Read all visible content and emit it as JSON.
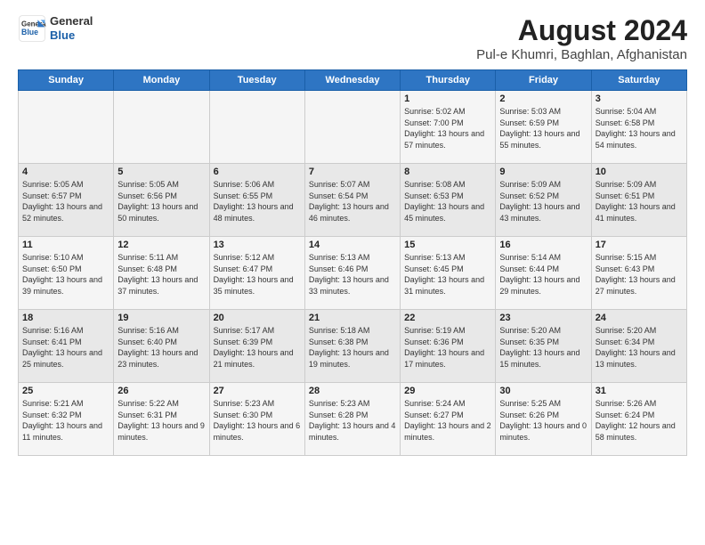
{
  "logo": {
    "line1": "General",
    "line2": "Blue"
  },
  "title": "August 2024",
  "subtitle": "Pul-e Khumri, Baghlan, Afghanistan",
  "days_of_week": [
    "Sunday",
    "Monday",
    "Tuesday",
    "Wednesday",
    "Thursday",
    "Friday",
    "Saturday"
  ],
  "weeks": [
    [
      {
        "day": "",
        "content": ""
      },
      {
        "day": "",
        "content": ""
      },
      {
        "day": "",
        "content": ""
      },
      {
        "day": "",
        "content": ""
      },
      {
        "day": "1",
        "content": "Sunrise: 5:02 AM\nSunset: 7:00 PM\nDaylight: 13 hours\nand 57 minutes."
      },
      {
        "day": "2",
        "content": "Sunrise: 5:03 AM\nSunset: 6:59 PM\nDaylight: 13 hours\nand 55 minutes."
      },
      {
        "day": "3",
        "content": "Sunrise: 5:04 AM\nSunset: 6:58 PM\nDaylight: 13 hours\nand 54 minutes."
      }
    ],
    [
      {
        "day": "4",
        "content": "Sunrise: 5:05 AM\nSunset: 6:57 PM\nDaylight: 13 hours\nand 52 minutes."
      },
      {
        "day": "5",
        "content": "Sunrise: 5:05 AM\nSunset: 6:56 PM\nDaylight: 13 hours\nand 50 minutes."
      },
      {
        "day": "6",
        "content": "Sunrise: 5:06 AM\nSunset: 6:55 PM\nDaylight: 13 hours\nand 48 minutes."
      },
      {
        "day": "7",
        "content": "Sunrise: 5:07 AM\nSunset: 6:54 PM\nDaylight: 13 hours\nand 46 minutes."
      },
      {
        "day": "8",
        "content": "Sunrise: 5:08 AM\nSunset: 6:53 PM\nDaylight: 13 hours\nand 45 minutes."
      },
      {
        "day": "9",
        "content": "Sunrise: 5:09 AM\nSunset: 6:52 PM\nDaylight: 13 hours\nand 43 minutes."
      },
      {
        "day": "10",
        "content": "Sunrise: 5:09 AM\nSunset: 6:51 PM\nDaylight: 13 hours\nand 41 minutes."
      }
    ],
    [
      {
        "day": "11",
        "content": "Sunrise: 5:10 AM\nSunset: 6:50 PM\nDaylight: 13 hours\nand 39 minutes."
      },
      {
        "day": "12",
        "content": "Sunrise: 5:11 AM\nSunset: 6:48 PM\nDaylight: 13 hours\nand 37 minutes."
      },
      {
        "day": "13",
        "content": "Sunrise: 5:12 AM\nSunset: 6:47 PM\nDaylight: 13 hours\nand 35 minutes."
      },
      {
        "day": "14",
        "content": "Sunrise: 5:13 AM\nSunset: 6:46 PM\nDaylight: 13 hours\nand 33 minutes."
      },
      {
        "day": "15",
        "content": "Sunrise: 5:13 AM\nSunset: 6:45 PM\nDaylight: 13 hours\nand 31 minutes."
      },
      {
        "day": "16",
        "content": "Sunrise: 5:14 AM\nSunset: 6:44 PM\nDaylight: 13 hours\nand 29 minutes."
      },
      {
        "day": "17",
        "content": "Sunrise: 5:15 AM\nSunset: 6:43 PM\nDaylight: 13 hours\nand 27 minutes."
      }
    ],
    [
      {
        "day": "18",
        "content": "Sunrise: 5:16 AM\nSunset: 6:41 PM\nDaylight: 13 hours\nand 25 minutes."
      },
      {
        "day": "19",
        "content": "Sunrise: 5:16 AM\nSunset: 6:40 PM\nDaylight: 13 hours\nand 23 minutes."
      },
      {
        "day": "20",
        "content": "Sunrise: 5:17 AM\nSunset: 6:39 PM\nDaylight: 13 hours\nand 21 minutes."
      },
      {
        "day": "21",
        "content": "Sunrise: 5:18 AM\nSunset: 6:38 PM\nDaylight: 13 hours\nand 19 minutes."
      },
      {
        "day": "22",
        "content": "Sunrise: 5:19 AM\nSunset: 6:36 PM\nDaylight: 13 hours\nand 17 minutes."
      },
      {
        "day": "23",
        "content": "Sunrise: 5:20 AM\nSunset: 6:35 PM\nDaylight: 13 hours\nand 15 minutes."
      },
      {
        "day": "24",
        "content": "Sunrise: 5:20 AM\nSunset: 6:34 PM\nDaylight: 13 hours\nand 13 minutes."
      }
    ],
    [
      {
        "day": "25",
        "content": "Sunrise: 5:21 AM\nSunset: 6:32 PM\nDaylight: 13 hours\nand 11 minutes."
      },
      {
        "day": "26",
        "content": "Sunrise: 5:22 AM\nSunset: 6:31 PM\nDaylight: 13 hours\nand 9 minutes."
      },
      {
        "day": "27",
        "content": "Sunrise: 5:23 AM\nSunset: 6:30 PM\nDaylight: 13 hours\nand 6 minutes."
      },
      {
        "day": "28",
        "content": "Sunrise: 5:23 AM\nSunset: 6:28 PM\nDaylight: 13 hours\nand 4 minutes."
      },
      {
        "day": "29",
        "content": "Sunrise: 5:24 AM\nSunset: 6:27 PM\nDaylight: 13 hours\nand 2 minutes."
      },
      {
        "day": "30",
        "content": "Sunrise: 5:25 AM\nSunset: 6:26 PM\nDaylight: 13 hours\nand 0 minutes."
      },
      {
        "day": "31",
        "content": "Sunrise: 5:26 AM\nSunset: 6:24 PM\nDaylight: 12 hours\nand 58 minutes."
      }
    ]
  ]
}
